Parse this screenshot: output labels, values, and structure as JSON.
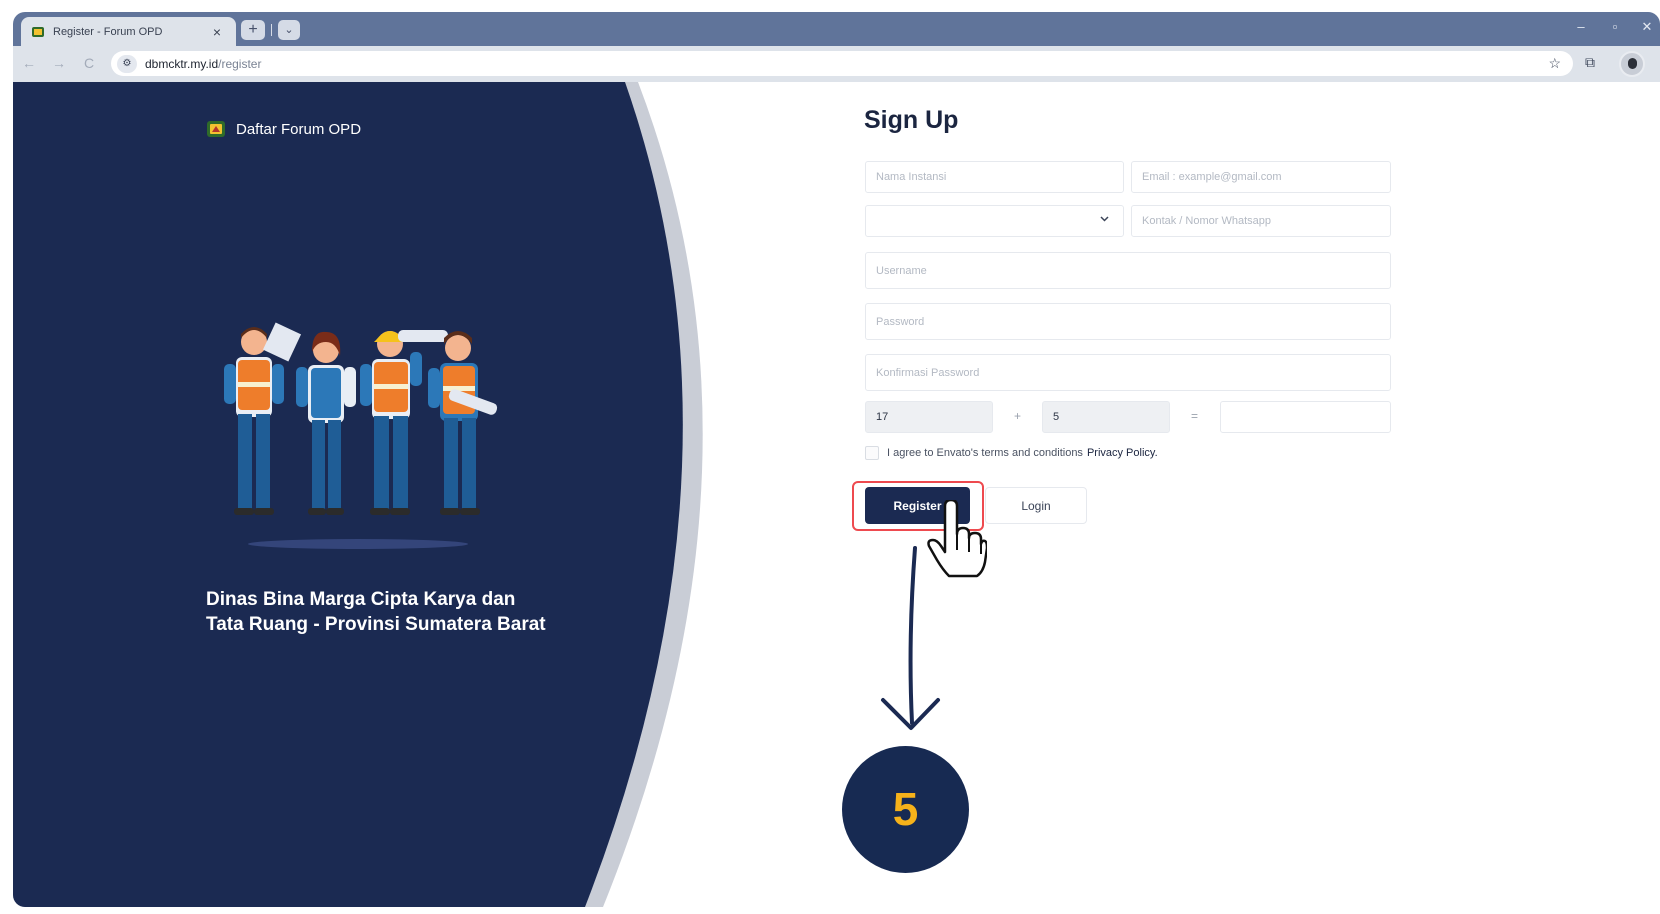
{
  "browser": {
    "tab_title": "Register - Forum OPD",
    "tab_close": "×",
    "new_tab": "+",
    "tab_menu": "⌄",
    "window_controls": {
      "minimize": "–",
      "maximize": "▫",
      "close": "✕"
    },
    "nav": {
      "back": "←",
      "forward": "→",
      "reload": "C"
    },
    "site_info_icon": "tune-icon",
    "url_host": "dbmcktr.my.id",
    "url_path": "/register",
    "bookmark_icon": "☆",
    "extensions_icon": "⧉"
  },
  "colors": {
    "panel_navy": "#1b2a52",
    "accent_red": "#ee4a4f",
    "badge_yellow": "#f6b21a"
  },
  "left_panel": {
    "brand_name": "Daftar Forum OPD",
    "agency_line1": "Dinas Bina Marga Cipta Karya dan",
    "agency_line2": "Tata Ruang - Provinsi Sumatera Barat"
  },
  "form": {
    "title": "Sign Up",
    "nama_instansi_placeholder": "Nama Instansi",
    "email_placeholder": "Email : example@gmail.com",
    "select_value": "",
    "kontak_placeholder": "Kontak / Nomor Whatsapp",
    "username_placeholder": "Username",
    "password_placeholder": "Password",
    "konfirmasi_placeholder": "Konfirmasi Password",
    "captcha_a": "17",
    "captcha_plus": "+",
    "captcha_b": "5",
    "captcha_equals": "=",
    "captcha_answer": "",
    "agree_text": "I agree to Envato's terms and conditions",
    "agree_link": "Privacy Policy.",
    "register_label": "Register",
    "login_label": "Login"
  },
  "step": {
    "number": "5"
  }
}
